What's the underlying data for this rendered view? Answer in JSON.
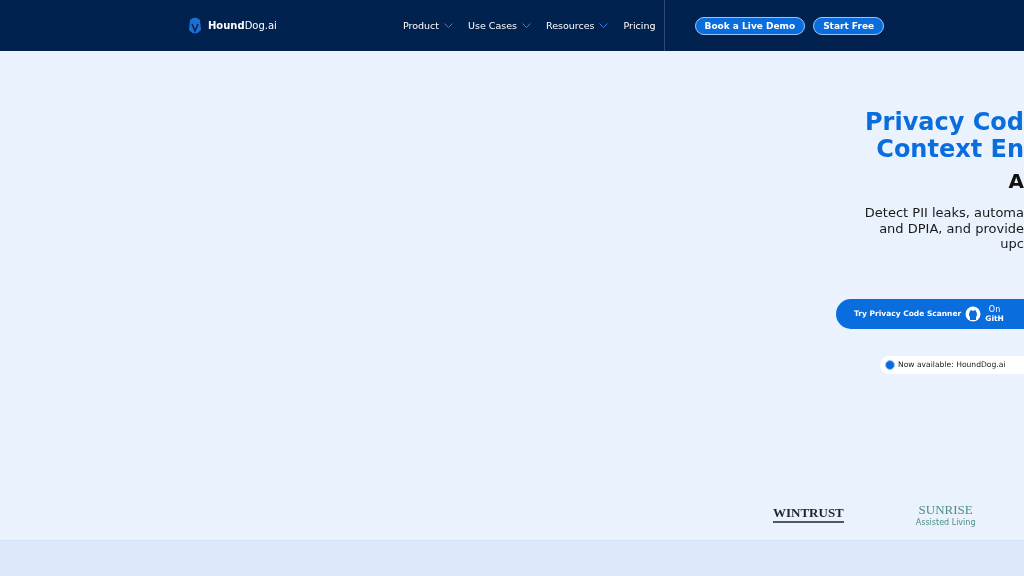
{
  "nav": {
    "logo": {
      "bold": "Hound",
      "rest": "Dog.ai"
    },
    "menu": [
      {
        "label": "Product",
        "dropdown": true
      },
      {
        "label": "Use Cases",
        "dropdown": true
      },
      {
        "label": "Resources",
        "dropdown": true
      },
      {
        "label": "Pricing",
        "dropdown": false
      }
    ],
    "buttons": [
      "Book a Live Demo",
      "Start Free"
    ]
  },
  "hero": {
    "title_lines": [
      "Privacy Cod",
      "Context En"
    ],
    "subtitle": "A",
    "description_lines": [
      "Detect PII leaks, automa",
      "and DPIA, and provide",
      "upc"
    ],
    "cta": {
      "label": "Try Privacy Code Scanner",
      "badge_top": "On",
      "badge_bottom": "GitH"
    },
    "announcement": "Now available: HoundDog.ai"
  },
  "logos": [
    {
      "name": "WINTRUST",
      "kind": "serif"
    },
    {
      "name": "SUNRISE",
      "tagline": "Assisted Living",
      "kind": "green"
    }
  ]
}
